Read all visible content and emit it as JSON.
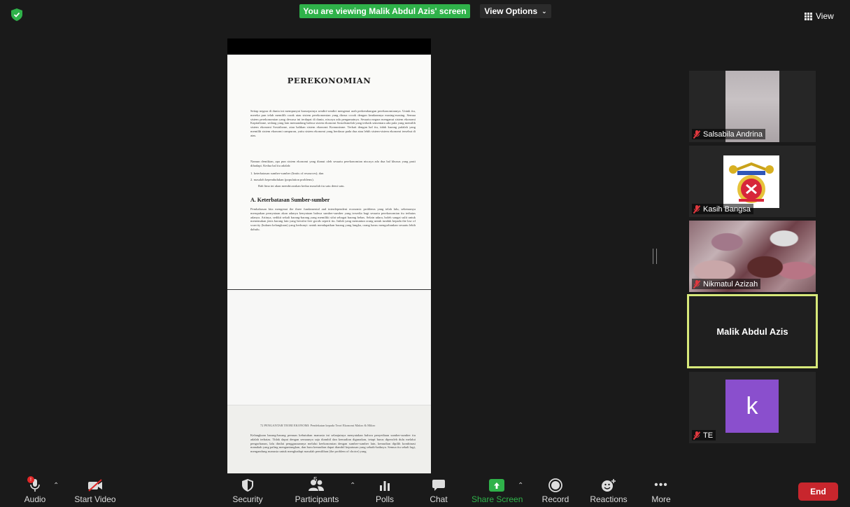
{
  "top": {
    "banner": "You are viewing Malik Abdul Azis' screen",
    "view_options": "View Options",
    "view": "View"
  },
  "shared_doc": {
    "title": "Perekonomian",
    "para1": "Setiap negara di dunia ini mempunyai konsepsinya sendiri-sendiri mengenai arah perkembangan perekonomiannya. Untuk itu, mereka pun telah memilih corak atau sistem perekonomian yang dirasa cocok dengan keadaannya masing-masing. Semua sistem perekonomian yang dewasa ini terdapat di dunia, niscaya ada pengamatnya. Sesuatu negara menganut sistem ekonomi Kapitalisme, sedang yang lain memandang bahwa sistem ekonomi Sosialismelah yang terbaik sementara ada pula yang memilih sistem ekonomi Sosialisme, atau bahkan sistem ekonomi Komunisme. Terkait dengan hal itu, tidak kurang pulalah yang memilih sistem ekonomi campuran, yaitu sistem ekonomi yang berdasar pada dua atau lebih sistem-sistem ekonomi tersebut di atas.",
    "para2": "Namun demikian, apa pun sistem ekonomi yang dianut oleh sesuatu perekonomian niscaya ada dua hal khusus yang pasti dihadapi. Kedua hal itu adalah:",
    "list1": "1.   keterbatasan sumber-sumber (limits of resources); dan",
    "list2": "2.   masalah kependudukan (population problems).",
    "list_note": "Bab lima ini akan membicarakan kedua masalah itu satu demi satu.",
    "section": "A.  Keterbatasan Sumber-sumber",
    "para3": "Pembahasan kita mengenai the three fundamental and interdependent economic problems yang telah lalu, sebenarnya merupakan pernyataan akan adanya kenyataan bahwa sumber-sumber yang tersedia bagi sesuatu perekonomian itu terbatas adanya. Artinya, sedikit sekali barang-barang yang memiliki sifat sebagai barang bebas. Selain udara, boleh sangat sulit untuk menemukan jenis barang lain yang bersifat free goods seperti itu. Inilah yang menuntun orang untuk tunduk kepada the law of scarcity (hukum kelangkaan) yang berbunyi: untuk mendapatkan barang yang langka, orang harus mengorbankan sesuatu lebih dahulu.",
    "footer": "72     PENGANTAR TEORI EKONOMI: Pendekatan kepada Teori Ekonomi Makro & Mikro",
    "para4": "Kelangkaan barang-barang pemuas kebutuhan manusia ini selanjutnya menyatakan bahwa penyediaan sumber-sumber itu adalah terbatas. Tidak dapat dengan semaunya saja diambil dan kemudian digunakan, tetapi harus diperoleh dulu melalui pengorbanan, lalu dinilai penggunaannya melalui keekonomian dengan sumber-sumber lain, kemudian dipilih kombinasi manakah yang paling menguntungkan, dan baru kemudian dapat diambil keputusan yang sebaik-baiknya. Semua itu sekali lagi, mengandung manusia untuk menghadapi masalah pemilihan (the problem of choice) yang"
  },
  "participants": [
    {
      "name": "Salsabila Andrina",
      "muted": true
    },
    {
      "name": "Kasih Bangsa",
      "muted": true
    },
    {
      "name": "Nikmatul Azizah",
      "muted": true
    },
    {
      "name": "Malik Abdul Azis",
      "muted": false
    },
    {
      "name": "TE",
      "avatar_letter": "k",
      "avatar_color": "#8a4fcd",
      "muted": true
    }
  ],
  "toolbar": {
    "audio": "Audio",
    "audio_badge": "!",
    "start_video": "Start Video",
    "security": "Security",
    "participants": "Participants",
    "participants_count": "5",
    "polls": "Polls",
    "chat": "Chat",
    "share_screen": "Share Screen",
    "record": "Record",
    "reactions": "Reactions",
    "more": "More",
    "end": "End"
  },
  "colors": {
    "banner_green": "#2fb24a",
    "active_speaker_border": "#d7e97a",
    "end_red": "#c8262d",
    "avatar_purple": "#8a4fcd"
  }
}
